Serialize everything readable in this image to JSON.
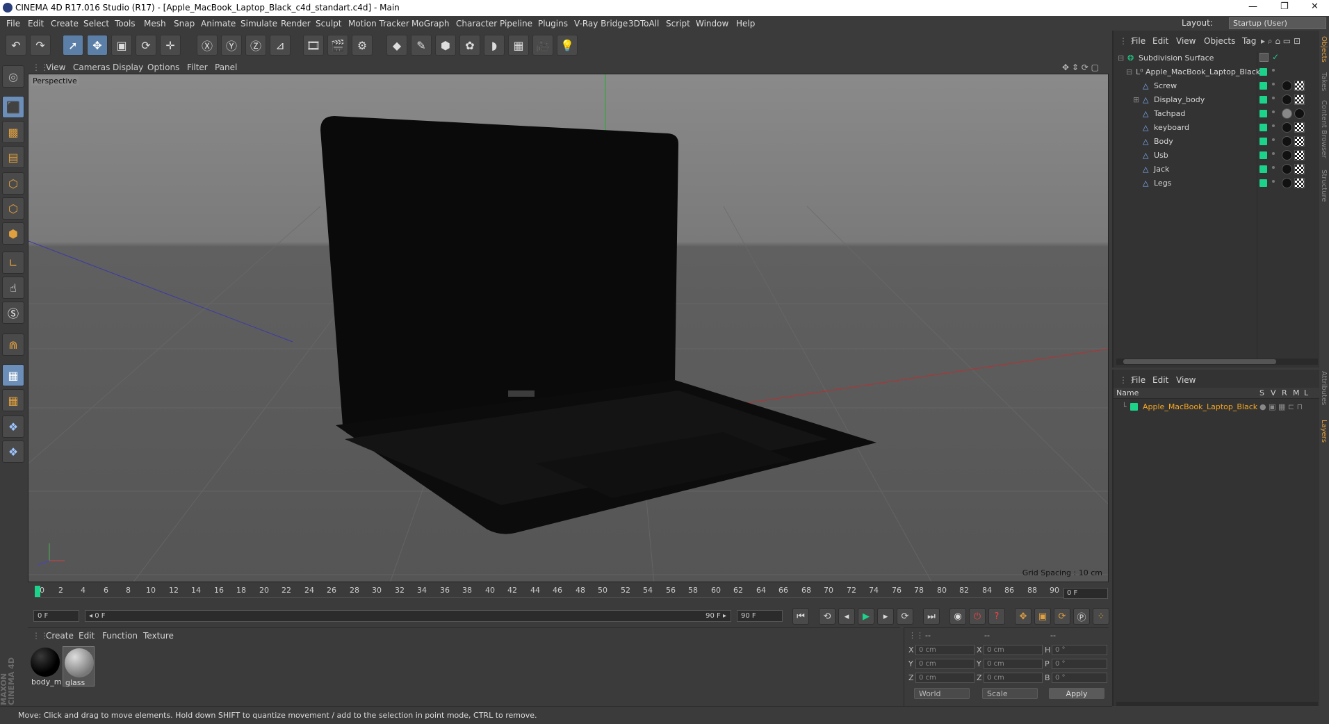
{
  "window": {
    "title": "CINEMA 4D R17.016 Studio (R17) - [Apple_MacBook_Laptop_Black_c4d_standart.c4d] - Main",
    "minimize": "—",
    "restore": "❐",
    "close": "✕"
  },
  "menu": [
    "File",
    "Edit",
    "Create",
    "Select",
    "Tools",
    "Mesh",
    "Snap",
    "Animate",
    "Simulate",
    "Render",
    "Sculpt",
    "Motion Tracker",
    "MoGraph",
    "Character",
    "Pipeline",
    "Plugins",
    "V-Ray Bridge",
    "3DToAll",
    "Script",
    "Window",
    "Help"
  ],
  "layout": {
    "label": "Layout:",
    "value": "Startup (User)"
  },
  "viewport": {
    "menu": [
      "View",
      "Cameras",
      "Display",
      "Options",
      "Filter",
      "Panel"
    ],
    "camera_label": "Perspective",
    "grid_spacing": "Grid Spacing : 10 cm"
  },
  "timeline": {
    "ticks": [
      "0",
      "2",
      "4",
      "6",
      "8",
      "10",
      "12",
      "14",
      "16",
      "18",
      "20",
      "22",
      "24",
      "26",
      "28",
      "30",
      "32",
      "34",
      "36",
      "38",
      "40",
      "42",
      "44",
      "46",
      "48",
      "50",
      "52",
      "54",
      "56",
      "58",
      "60",
      "62",
      "64",
      "66",
      "68",
      "70",
      "72",
      "74",
      "76",
      "78",
      "80",
      "82",
      "84",
      "86",
      "88",
      "90"
    ],
    "current_frame": "0 F",
    "start_field": "0 F",
    "range_start": "◂ 0 F",
    "range_end": "90 F ▸",
    "end_field": "90 F"
  },
  "materials": {
    "menu": [
      "Create",
      "Edit",
      "Function",
      "Texture"
    ],
    "items": [
      {
        "name": "body_m",
        "color": "#0b0b0b"
      },
      {
        "name": "glass",
        "color": "#9a9a9a"
      }
    ]
  },
  "coords": {
    "header": [
      "--",
      "--",
      "--"
    ],
    "rows": [
      {
        "a": "X",
        "av": "0 cm",
        "b": "X",
        "bv": "0 cm",
        "c": "H",
        "cv": "0 °"
      },
      {
        "a": "Y",
        "av": "0 cm",
        "b": "Y",
        "bv": "0 cm",
        "c": "P",
        "cv": "0 °"
      },
      {
        "a": "Z",
        "av": "0 cm",
        "b": "Z",
        "bv": "0 cm",
        "c": "B",
        "cv": "0 °"
      }
    ],
    "mode1": "World",
    "mode2": "Scale",
    "apply": "Apply"
  },
  "objects": {
    "menu": [
      "File",
      "Edit",
      "View",
      "Objects",
      "Tag"
    ],
    "items": [
      {
        "name": "Subdivision Surface",
        "depth": 0
      },
      {
        "name": "Apple_MacBook_Laptop_Black",
        "depth": 1
      },
      {
        "name": "Screw",
        "depth": 2
      },
      {
        "name": "Display_body",
        "depth": 2
      },
      {
        "name": "Tachpad",
        "depth": 2
      },
      {
        "name": "keyboard",
        "depth": 2
      },
      {
        "name": "Body",
        "depth": 2
      },
      {
        "name": "Usb",
        "depth": 2
      },
      {
        "name": "Jack",
        "depth": 2
      },
      {
        "name": "Legs",
        "depth": 2
      }
    ]
  },
  "layers": {
    "menu": [
      "File",
      "Edit",
      "View"
    ],
    "columns": {
      "name": "Name",
      "s": "S",
      "v": "V",
      "r": "R",
      "m": "M",
      "l": "L"
    },
    "items": [
      {
        "name": "Apple_MacBook_Laptop_Black",
        "color": "#1cd38a"
      }
    ],
    "highlight_color": "#f5a623"
  },
  "status": "Move: Click and drag to move elements. Hold down SHIFT to quantize movement / add to the selection in point mode, CTRL to remove.",
  "brand": "MAXON CINEMA 4D",
  "side_tabs": [
    "Objects",
    "Takes",
    "Content Browser",
    "Structure",
    "Attributes",
    "Layers"
  ]
}
